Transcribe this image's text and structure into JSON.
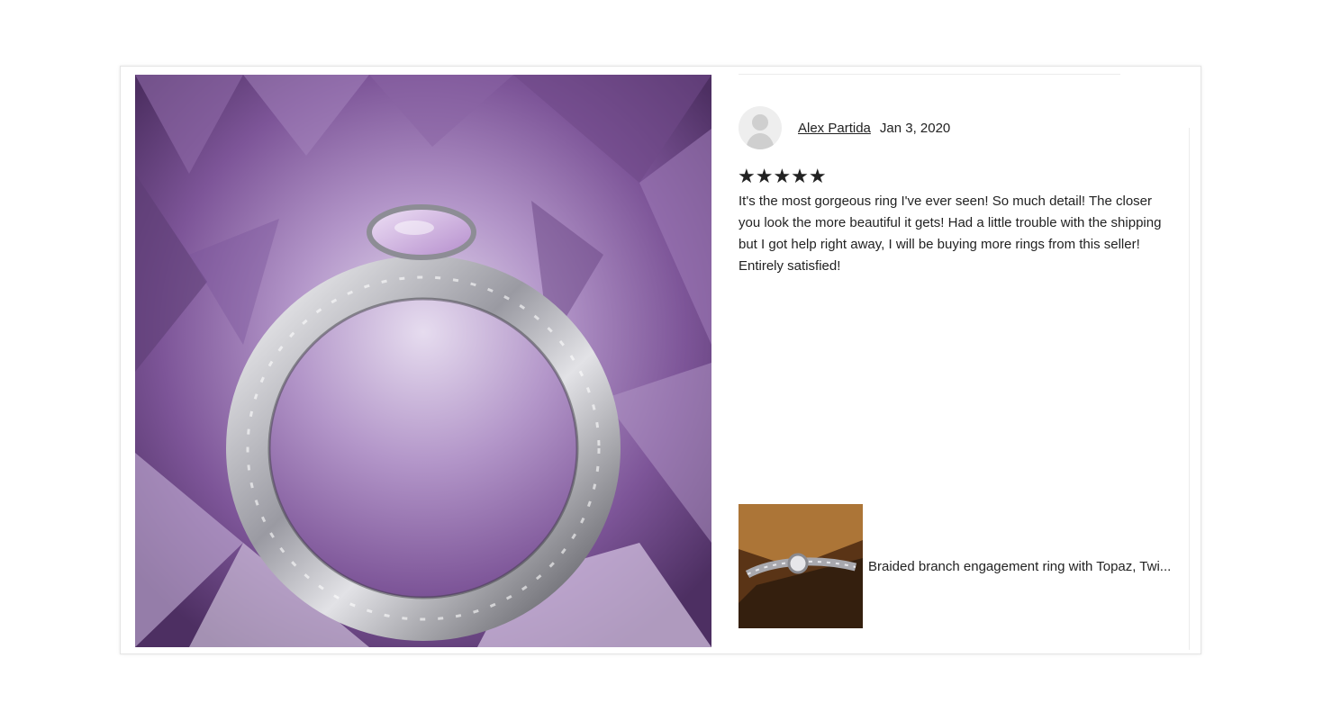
{
  "review": {
    "reviewer_name": "Alex Partida",
    "date": "Jan 3, 2020",
    "rating": 5,
    "stars_text": "★★★★★",
    "text": "It's the most gorgeous ring I've ever seen! So much detail! The closer you look the more beautiful it gets! Had a little trouble with the shipping but I got help right away, I will be buying more rings from this seller! Entirely satisfied!"
  },
  "product": {
    "title": "Braided branch engagement ring with Topaz, Twi..."
  },
  "colors": {
    "text": "#222222",
    "border": "#e4e4e4",
    "avatar_bg": "#eeeeee"
  },
  "icons": {
    "avatar": "person-silhouette-icon",
    "star": "star-icon"
  }
}
